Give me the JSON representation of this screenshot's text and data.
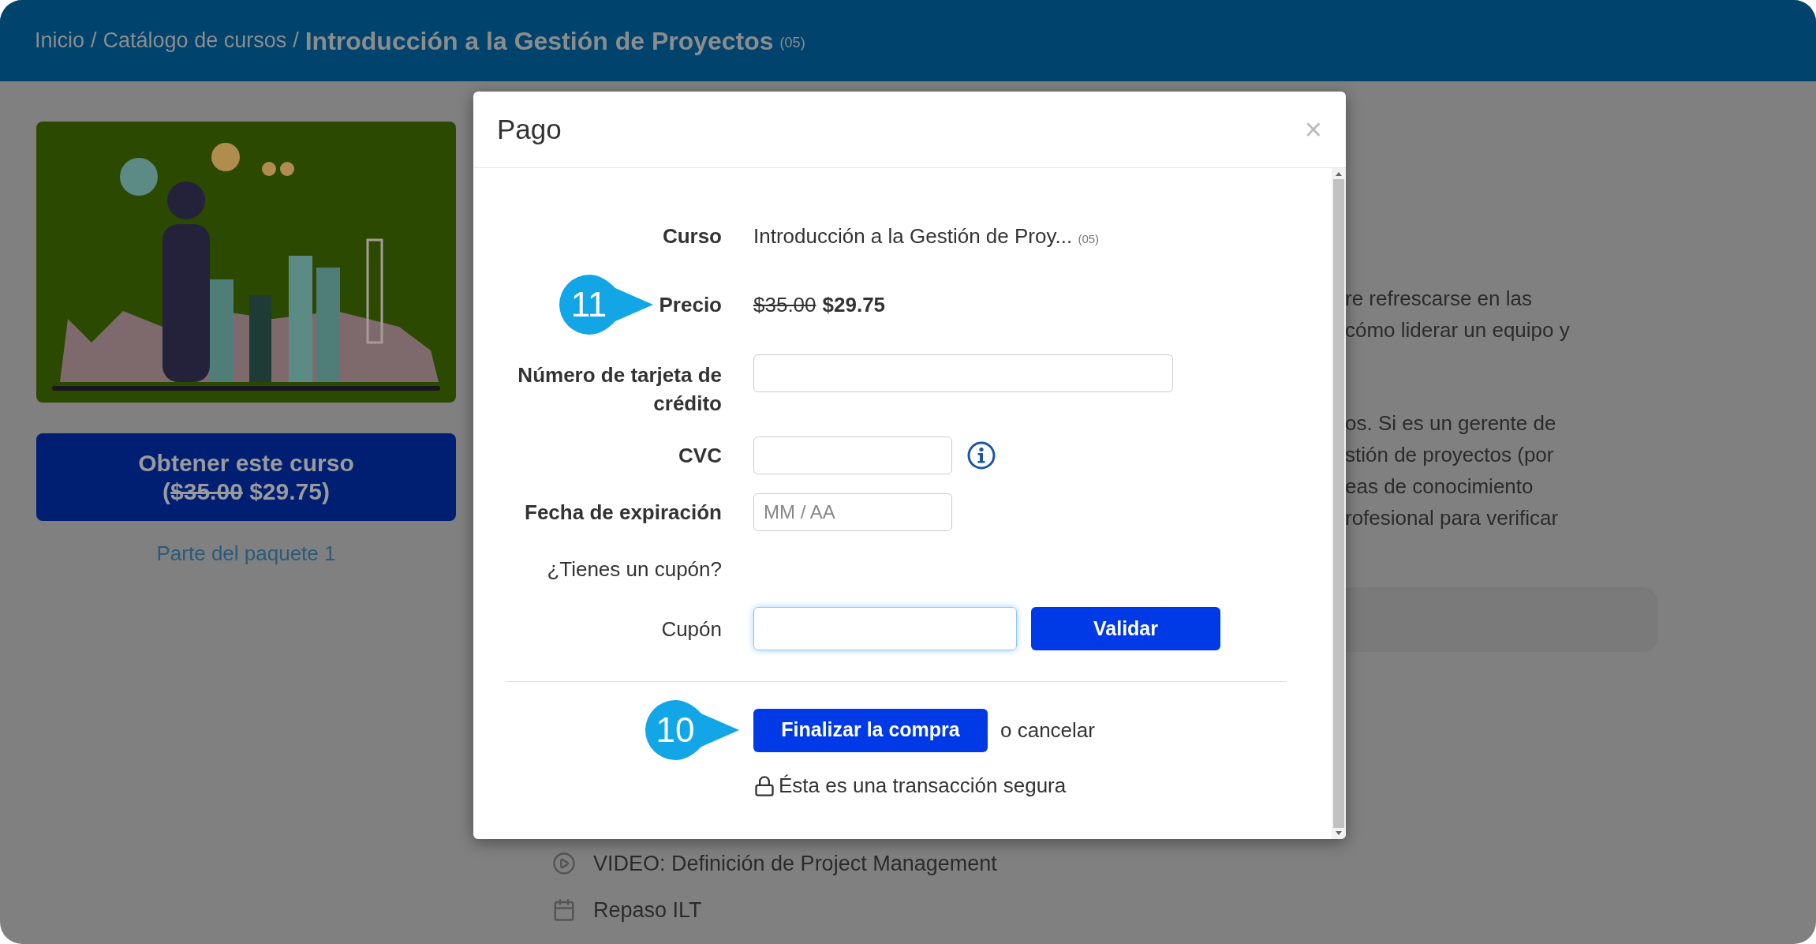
{
  "breadcrumb": {
    "links": [
      "Inicio",
      "Catálogo de cursos"
    ],
    "separator": "/",
    "current": "Introducción a la Gestión de Proyectos",
    "code": "(05)"
  },
  "course_card": {
    "buy_button": {
      "prefix": "Obtener este curso (",
      "old_price": "$35.00",
      "new_price": "$29.75",
      "suffix": ")"
    },
    "bundle_link": "Parte del paquete 1"
  },
  "description": [
    [
      "re refrescarse en las",
      "cómo liderar un equipo y"
    ],
    [
      "os. Si es un gerente de",
      "stión de proyectos (por",
      "eas de conocimiento",
      "rofesional para verificar"
    ]
  ],
  "outline": [
    {
      "kind": "video",
      "label": "VIDEO: Definición de Project Management"
    },
    {
      "kind": "event",
      "label": "Repaso ILT"
    }
  ],
  "modal": {
    "title": "Pago",
    "close": "×",
    "fields": [
      {
        "kind": "text",
        "label": "Curso",
        "value": "Introducción a la Gestión de Proy...",
        "code": "(05)"
      },
      {
        "kind": "price",
        "label": "Precio",
        "old_price": "$35.00",
        "new_price": "$29.75",
        "callout": "11"
      },
      {
        "kind": "wideinput",
        "label": "Número de tarjeta de crédito"
      },
      {
        "kind": "input",
        "label": "CVC",
        "info": true
      },
      {
        "kind": "input",
        "label": "Fecha de expiración",
        "placeholder": "MM / AA"
      },
      {
        "kind": "note",
        "label": "¿Tienes un cupón?"
      },
      {
        "kind": "coupon",
        "label": "Cupón",
        "focused": true,
        "button": "Validar"
      }
    ],
    "submit": {
      "label": "Finalizar la compra",
      "cancel": "o cancelar",
      "callout": "10"
    },
    "secure_note": "Ésta es una transacción segura"
  }
}
